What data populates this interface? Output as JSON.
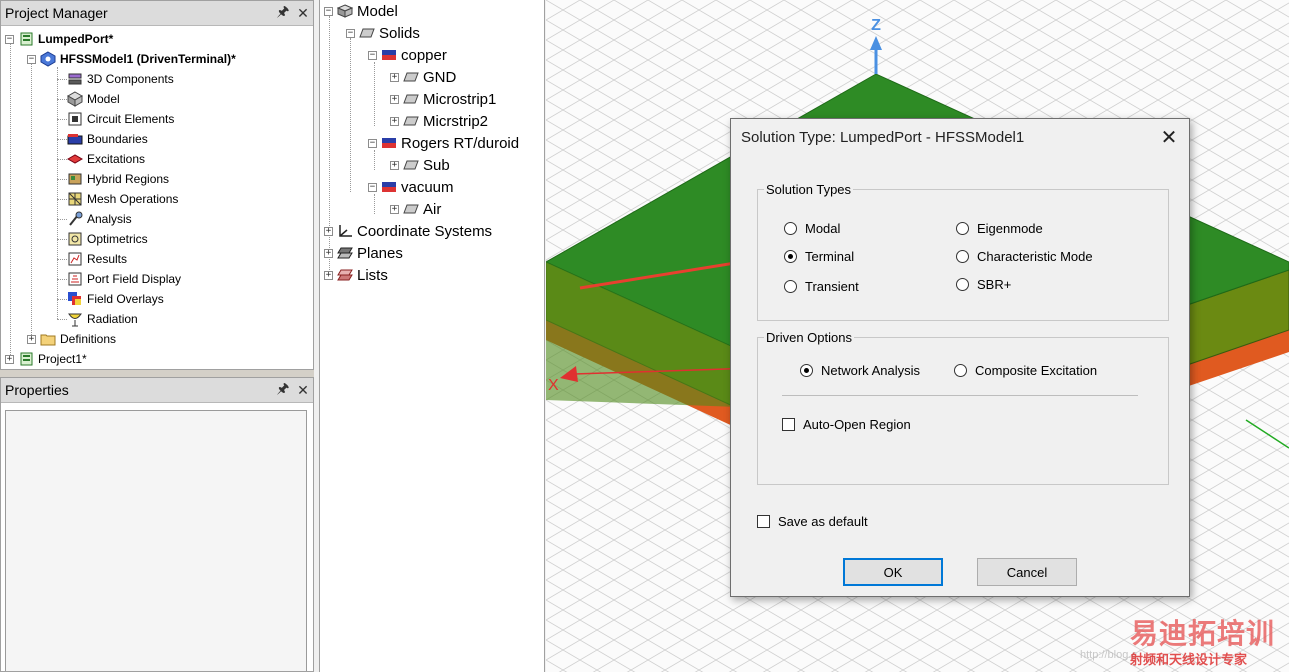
{
  "project_manager": {
    "title": "Project Manager",
    "pin_glyph": "↕",
    "close_glyph": "✕",
    "tree": [
      {
        "label": "LumpedPort*",
        "bold": true,
        "icon": "project-icon"
      },
      {
        "label": "HFSSModel1 (DrivenTerminal)*",
        "bold": true,
        "icon": "design-icon"
      },
      {
        "label": "3D Components",
        "icon": "components-icon"
      },
      {
        "label": "Model",
        "icon": "model-icon"
      },
      {
        "label": "Circuit Elements",
        "icon": "circuit-icon"
      },
      {
        "label": "Boundaries",
        "icon": "boundaries-icon"
      },
      {
        "label": "Excitations",
        "icon": "excitations-icon"
      },
      {
        "label": "Hybrid Regions",
        "icon": "hybrid-icon"
      },
      {
        "label": "Mesh Operations",
        "icon": "mesh-icon"
      },
      {
        "label": "Analysis",
        "icon": "analysis-icon"
      },
      {
        "label": "Optimetrics",
        "icon": "optimetrics-icon"
      },
      {
        "label": "Results",
        "icon": "results-icon"
      },
      {
        "label": "Port Field Display",
        "icon": "port-field-icon"
      },
      {
        "label": "Field Overlays",
        "icon": "field-overlays-icon"
      },
      {
        "label": "Radiation",
        "icon": "radiation-icon"
      },
      {
        "label": "Definitions",
        "icon": "folder-icon"
      },
      {
        "label": "Project1*",
        "icon": "project-icon"
      }
    ]
  },
  "properties": {
    "title": "Properties",
    "pin_glyph": "↕",
    "close_glyph": "✕"
  },
  "model_tree": {
    "items": [
      {
        "label": "Model"
      },
      {
        "label": "Solids"
      },
      {
        "label": "copper"
      },
      {
        "label": "GND"
      },
      {
        "label": "Microstrip1"
      },
      {
        "label": "Micrstrip2"
      },
      {
        "label": "Rogers RT/duroid"
      },
      {
        "label": "Sub"
      },
      {
        "label": "vacuum"
      },
      {
        "label": "Air"
      },
      {
        "label": "Coordinate Systems"
      },
      {
        "label": "Planes"
      },
      {
        "label": "Lists"
      }
    ]
  },
  "viewport": {
    "axis_z": "Z",
    "axis_x": "X"
  },
  "dialog": {
    "title": "Solution Type: LumpedPort - HFSSModel1",
    "close_glyph": "✕",
    "solution_types_label": "Solution Types",
    "solution_types": [
      {
        "label": "Modal",
        "selected": false
      },
      {
        "label": "Terminal",
        "selected": true
      },
      {
        "label": "Transient",
        "selected": false
      },
      {
        "label": "Eigenmode",
        "selected": false
      },
      {
        "label": "Characteristic Mode",
        "selected": false
      },
      {
        "label": "SBR+",
        "selected": false
      }
    ],
    "driven_options_label": "Driven Options",
    "driven_options": [
      {
        "label": "Network Analysis",
        "selected": true
      },
      {
        "label": "Composite Excitation",
        "selected": false
      }
    ],
    "auto_open_region": "Auto-Open Region",
    "auto_open_checked": false,
    "save_as_default": "Save as default",
    "save_as_default_checked": false,
    "ok_label": "OK",
    "cancel_label": "Cancel"
  },
  "watermark": {
    "main": "易迪拓培训",
    "sub": "射频和天线设计专家",
    "blog": "http://blog.c"
  },
  "colors": {
    "substrate_top": "#2e8b25",
    "substrate_side": "#6b8a12",
    "ground": "#e05a20",
    "axis_z": "#4a90e2",
    "axis_x": "#e03030",
    "annotation_arrow": "#e8402f"
  }
}
